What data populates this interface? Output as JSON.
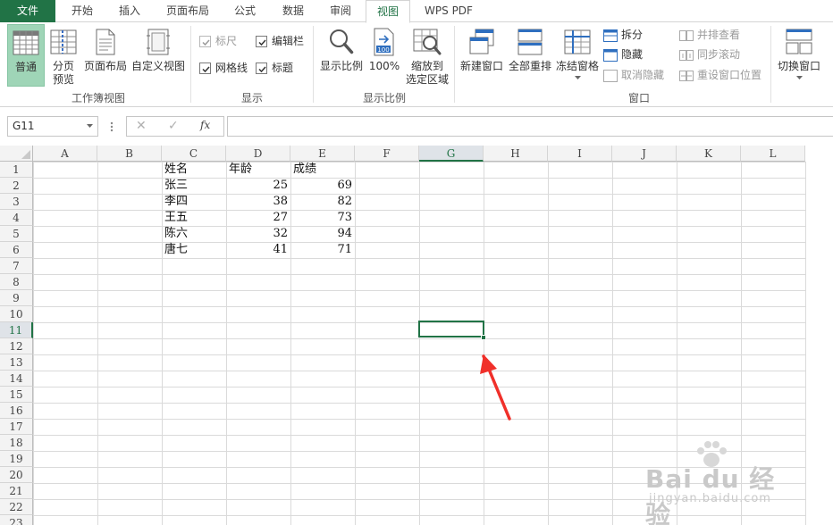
{
  "tabs": {
    "file": "文件",
    "home": "开始",
    "insert": "插入",
    "page_layout": "页面布局",
    "formulas": "公式",
    "data": "数据",
    "review": "审阅",
    "view": "视图",
    "wps_pdf": "WPS PDF",
    "active": "视图"
  },
  "ribbon": {
    "workbook_views": {
      "group_label": "工作簿视图",
      "normal": "普通",
      "page_break_1": "分页",
      "page_break_2": "预览",
      "page_layout": "页面布局",
      "custom_views": "自定义视图"
    },
    "show": {
      "group_label": "显示",
      "ruler": "标尺",
      "formula_bar": "编辑栏",
      "gridlines": "网格线",
      "headings": "标题"
    },
    "zoom": {
      "group_label": "显示比例",
      "zoom": "显示比例",
      "zoom_100": "100%",
      "zoom_selection_1": "缩放到",
      "zoom_selection_2": "选定区域"
    },
    "window": {
      "group_label": "窗口",
      "new_window": "新建窗口",
      "arrange_all": "全部重排",
      "freeze_panes": "冻结窗格",
      "split": "拆分",
      "hide": "隐藏",
      "unhide": "取消隐藏",
      "side_by_side": "并排查看",
      "sync_scroll": "同步滚动",
      "reset_position": "重设窗口位置",
      "switch_windows": "切换窗口"
    }
  },
  "formula_bar": {
    "name_box": "G11",
    "cancel_symbol": "✕",
    "enter_symbol": "✓",
    "fx_symbol": "fx",
    "formula": ""
  },
  "sheet": {
    "columns": [
      "A",
      "B",
      "C",
      "D",
      "E",
      "F",
      "G",
      "H",
      "I",
      "J",
      "K",
      "L"
    ],
    "rows": [
      "1",
      "2",
      "3",
      "4",
      "5",
      "6",
      "7",
      "8",
      "9",
      "10",
      "11",
      "12",
      "13",
      "14",
      "15",
      "16",
      "17",
      "18",
      "19",
      "20",
      "21",
      "22",
      "23"
    ],
    "selected_cell": "G11",
    "headers": {
      "name": "姓名",
      "age": "年龄",
      "score": "成绩"
    },
    "records": [
      {
        "name": "张三",
        "age": "25",
        "score": "69"
      },
      {
        "name": "李四",
        "age": "38",
        "score": "82"
      },
      {
        "name": "王五",
        "age": "27",
        "score": "73"
      },
      {
        "name": "陈六",
        "age": "32",
        "score": "94"
      },
      {
        "name": "唐七",
        "age": "41",
        "score": "71"
      }
    ]
  },
  "watermark": {
    "brand": "Bai du 经验",
    "url": "jingyan.baidu.com"
  },
  "colors": {
    "excel_green": "#217346",
    "pressed_button": "#9fd5b7",
    "arrow_red": "#f0302a"
  }
}
